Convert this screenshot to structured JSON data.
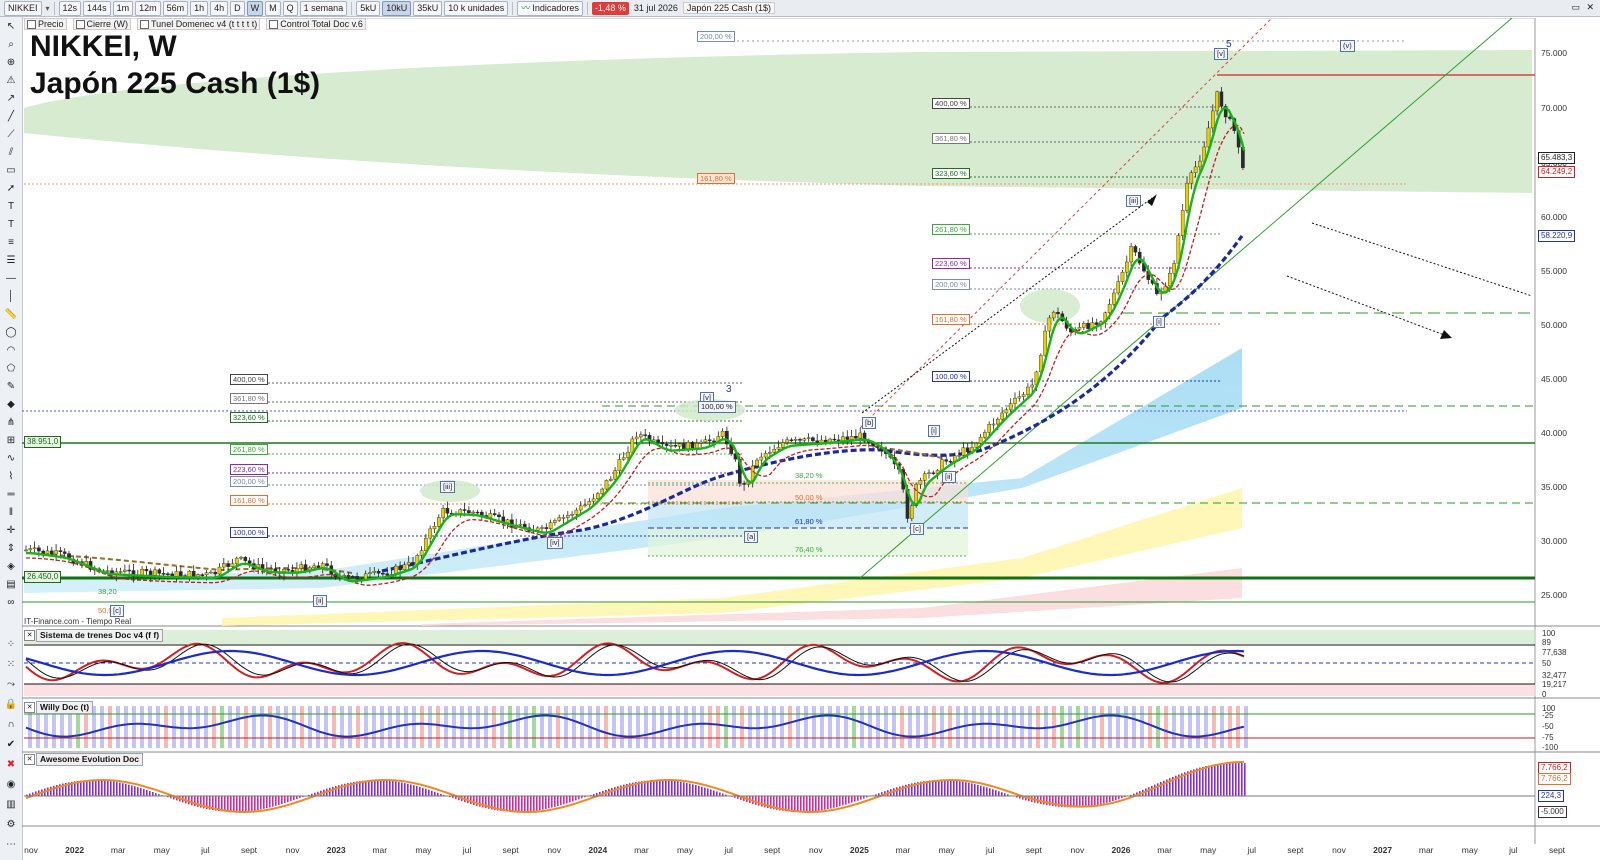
{
  "toolbar": {
    "symbol": "NIKKEI",
    "timeframes": [
      "12s",
      "144s",
      "1m",
      "12m",
      "56m",
      "1h",
      "4h",
      "D",
      "W",
      "M",
      "Q"
    ],
    "active_timeframe": "W",
    "period": "1 semana",
    "volumes": [
      "5kU",
      "10kU",
      "35kU"
    ],
    "active_volume": "10kU",
    "units": "10 k unidades",
    "indicators_label": "Indicadores",
    "change_badge": "-1,48 %",
    "date": "31 jul 2026",
    "instrument": "Japón 225 Cash (1$)"
  },
  "legend": {
    "items": [
      "Precio",
      "Cierre (W)",
      "Tunel Domenec v4 (t t t t t)",
      "Control Total Doc v.6"
    ]
  },
  "title": {
    "line1": "NIKKEI, W",
    "line2": "Japón 225 Cash (1$)"
  },
  "source": "IT-Finance.com - Tiempo Real",
  "price_axis": {
    "ticks": [
      "75.000",
      "70.000",
      "65.000",
      "60.000",
      "55.000",
      "50.000",
      "45.000",
      "40.000",
      "35.000",
      "30.000",
      "25.000"
    ],
    "tags": [
      {
        "text": "65.483,3",
        "color": "#222"
      },
      {
        "text": "64.249,2",
        "color": "#c22"
      },
      {
        "text": "58.220,9",
        "color": "#223399"
      }
    ],
    "left_tags": [
      "38.951,0",
      "26.450,0"
    ]
  },
  "time_axis": {
    "labels": [
      "nov",
      "2022",
      "mar",
      "may",
      "jul",
      "sept",
      "nov",
      "2023",
      "mar",
      "may",
      "jul",
      "sept",
      "nov",
      "2024",
      "mar",
      "may",
      "jul",
      "sept",
      "nov",
      "2025",
      "mar",
      "may",
      "jul",
      "sept",
      "nov",
      "2026",
      "mar",
      "may",
      "jul",
      "sept",
      "nov",
      "2027",
      "mar",
      "may",
      "jul",
      "sept"
    ]
  },
  "fib_levels": {
    "upper": [
      "400,00 %",
      "361,80 %",
      "323,60 %",
      "261,80 %",
      "223,60 %",
      "200,00 %",
      "161,80 %",
      "100,00 %"
    ],
    "upper_extra": [
      "200,00 %",
      "161,80 %"
    ],
    "lower": [
      "400,00 %",
      "361,80 %",
      "323,60 %",
      "261,80 %",
      "223,60 %",
      "200,00 %",
      "161,80 %",
      "100,00 %"
    ],
    "retrace": [
      "38,20 %",
      "50,00 %",
      "61,80 %",
      "76,40 %"
    ],
    "bottom": [
      "38,20",
      "50,0"
    ]
  },
  "waves": [
    "5",
    "[v]",
    "(v)",
    "[iii]",
    "3",
    "[v]",
    "100,00 %",
    "[b]",
    "[i]",
    "[ii]",
    "[iii]",
    "[iv]",
    "[a]",
    "[c]",
    "[ii]",
    "[i]",
    "[c]"
  ],
  "panes": {
    "trend": {
      "title": "Sistema de trenes Doc v4 (f f)",
      "ticks": [
        "100",
        "89",
        "77,638",
        "50",
        "32,477",
        "19,217",
        "0"
      ]
    },
    "willy": {
      "title": "Willy Doc (t)",
      "ticks": [
        "-25",
        "-50",
        "-75",
        "-100",
        "100"
      ]
    },
    "awesome": {
      "title": "Awesome Evolution Doc",
      "ticks": [
        "7.766,2",
        "7.766,2",
        "224,3",
        "-5.000"
      ]
    }
  },
  "colors": {
    "up": "#e6d000",
    "down": "#2b2b2b",
    "ma_green": "#17b317",
    "ma_red": "#c02020",
    "navy": "#1a2a9a",
    "fill_green": "#cfe8c8",
    "fill_cyan": "#a8e0f5",
    "fill_yellow": "#fff6b0",
    "fill_pink": "#fadadd"
  }
}
